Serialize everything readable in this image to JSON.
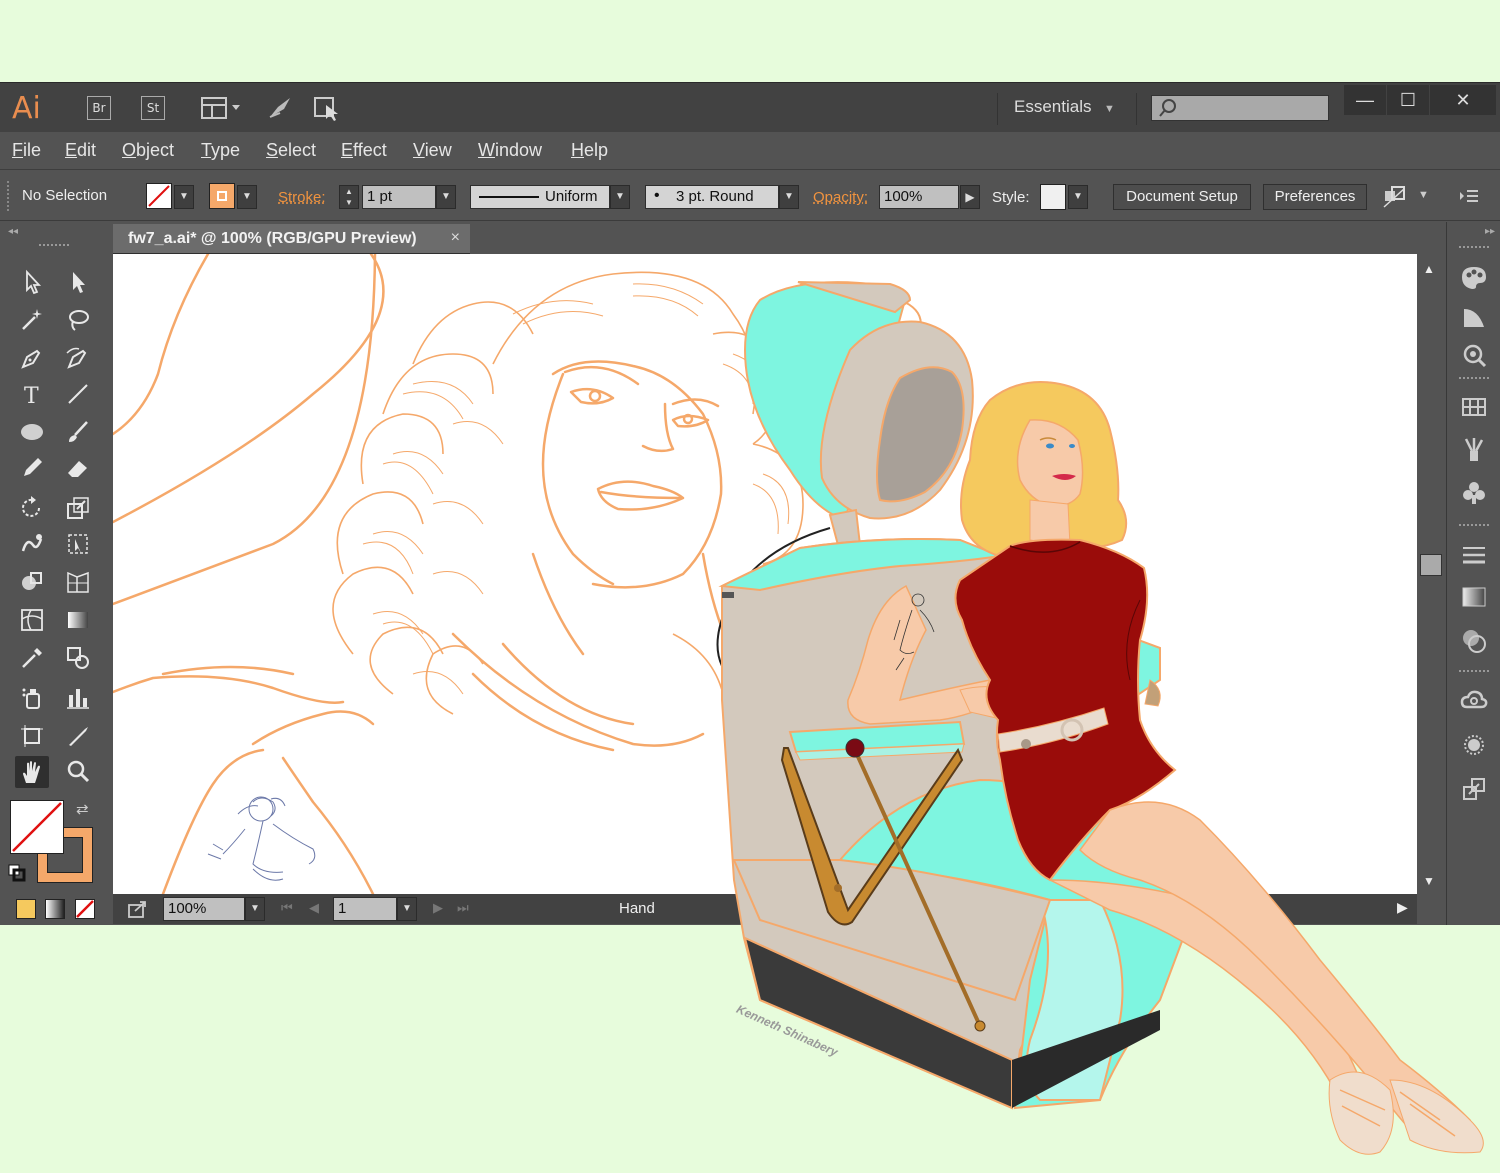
{
  "app": {
    "logo": "Ai",
    "bridge_label": "Br",
    "stock_label": "St",
    "workspace": "Essentials",
    "search_placeholder": "",
    "window_controls": {
      "minimize": "—",
      "maximize": "☐",
      "close": "✕"
    }
  },
  "menu": [
    "File",
    "Edit",
    "Object",
    "Type",
    "Select",
    "Effect",
    "View",
    "Window",
    "Help"
  ],
  "control": {
    "selection": "No Selection",
    "stroke_label": "Stroke:",
    "stroke_value": "1 pt",
    "profile": "Uniform",
    "brush": "3 pt. Round",
    "opacity_label": "Opacity:",
    "opacity_value": "100%",
    "style_label": "Style:",
    "document_setup": "Document Setup",
    "preferences": "Preferences"
  },
  "document": {
    "tab_title": "fw7_a.ai* @ 100% (RGB/GPU Preview)",
    "close": "×"
  },
  "status": {
    "zoom": "100%",
    "artboard": "1",
    "tool": "Hand"
  },
  "art": {
    "signature": "Kenneth Shinabery"
  },
  "colors": {
    "outline_orange": "#f5a86a",
    "dryer_cyan": "#7ef5e0",
    "chair_gray": "#d3c9bd",
    "dress_red": "#9a0c0a",
    "skin": "#f7caa9",
    "hair": "#f5c95e",
    "accent": "#f0933f"
  },
  "icons": {
    "tools": [
      "selection-tool",
      "direct-selection-tool",
      "magic-wand-tool",
      "lasso-tool",
      "pen-tool",
      "curvature-tool",
      "type-tool",
      "line-tool",
      "ellipse-tool",
      "paintbrush-tool",
      "pencil-tool",
      "eraser-tool",
      "rotate-tool",
      "scale-tool",
      "warp-tool",
      "free-transform-tool",
      "shape-builder-tool",
      "perspective-grid-tool",
      "mesh-tool",
      "gradient-tool",
      "eyedropper-tool",
      "blend-tool",
      "symbol-sprayer-tool",
      "column-graph-tool",
      "artboard-tool",
      "slice-tool",
      "hand-tool",
      "zoom-tool"
    ],
    "right_panel": [
      "color-panel-icon",
      "color-guide-icon",
      "color-themes-icon",
      "swatches-icon",
      "brushes-icon",
      "symbols-icon",
      "stroke-icon",
      "gradient-icon",
      "transparency-icon",
      "libraries-icon",
      "appearance-icon",
      "export-icon"
    ]
  }
}
